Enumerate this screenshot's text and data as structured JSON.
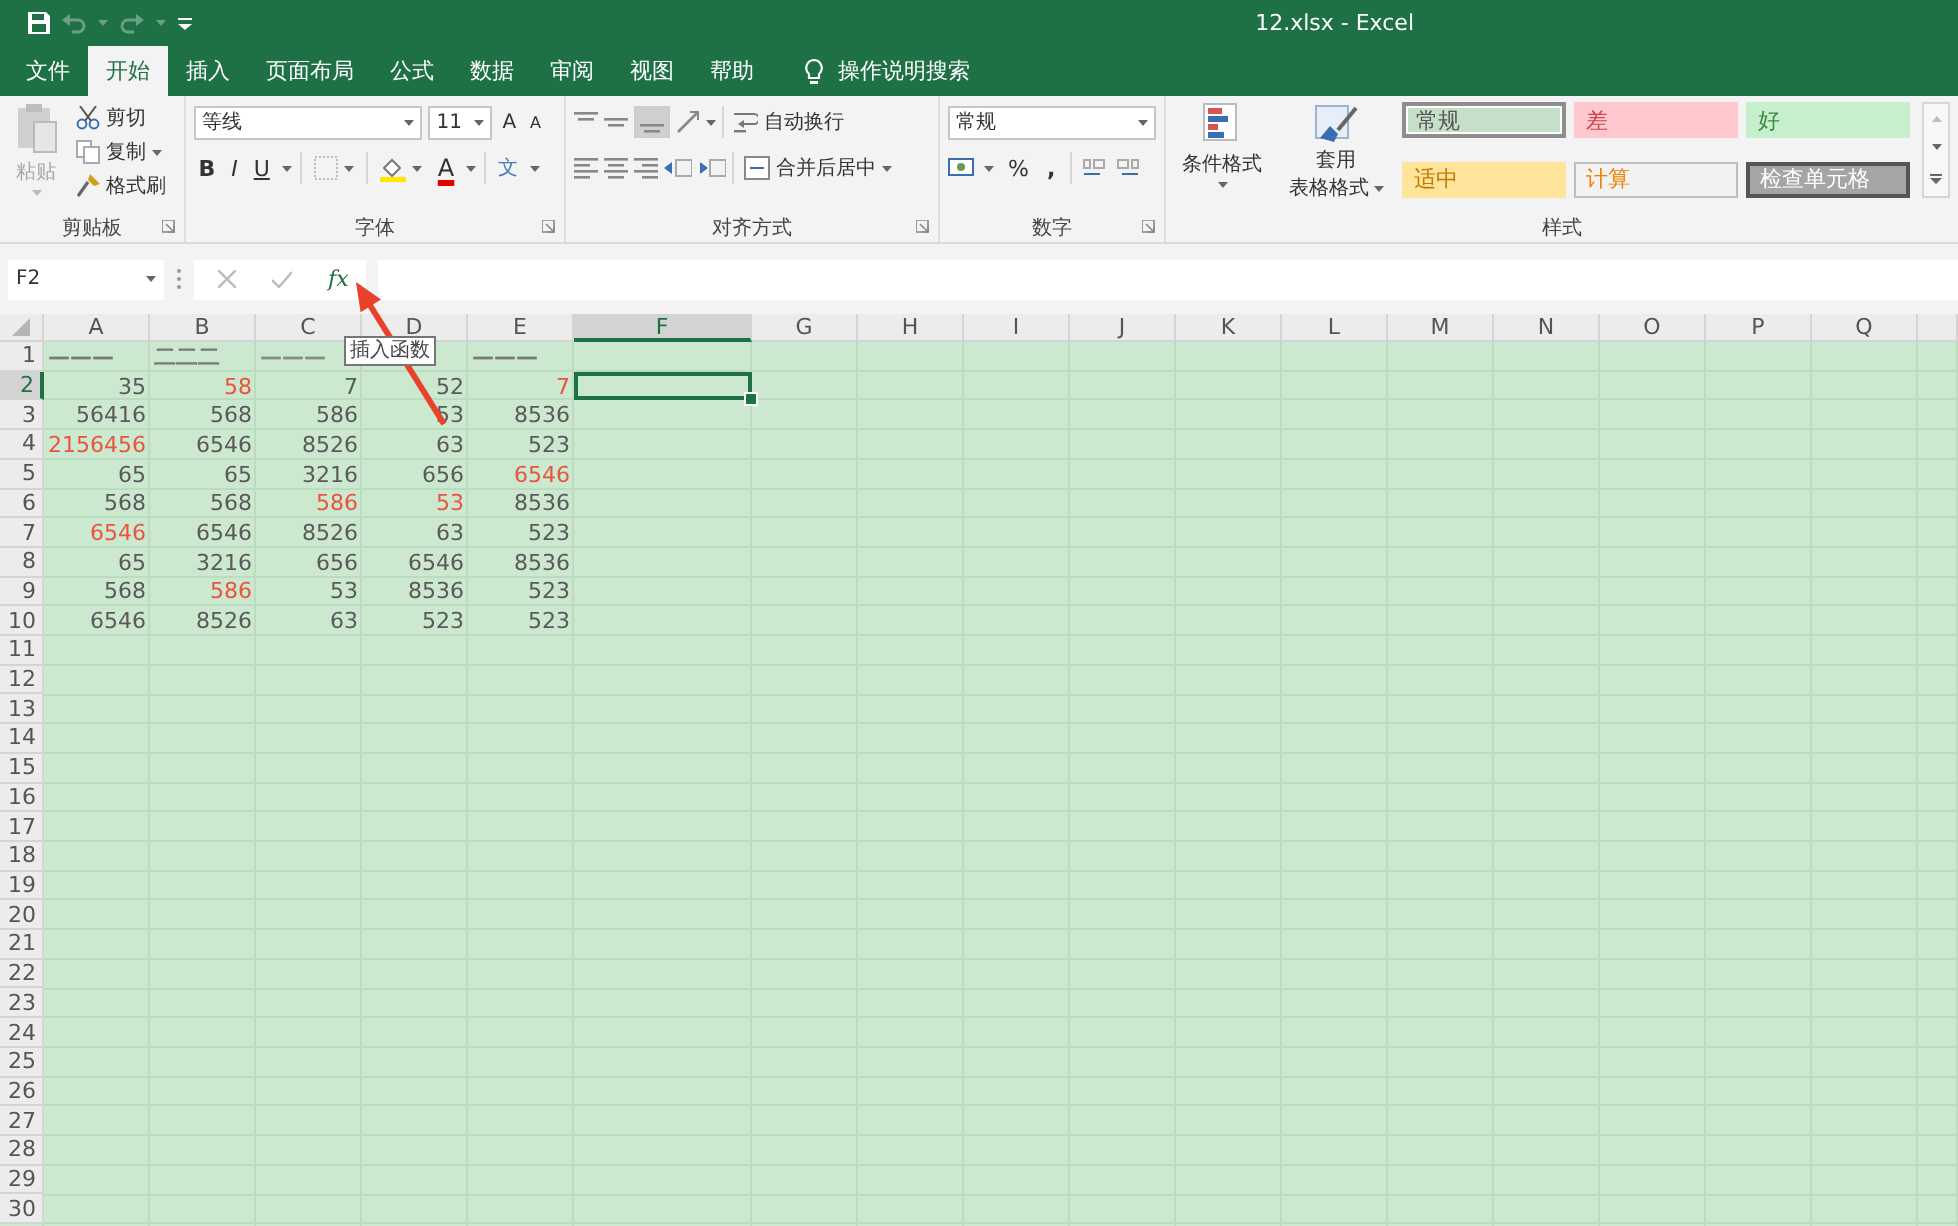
{
  "window": {
    "title": "12.xlsx  -  Excel"
  },
  "tabs": [
    {
      "label": "文件",
      "selected": false
    },
    {
      "label": "开始",
      "selected": true
    },
    {
      "label": "插入",
      "selected": false
    },
    {
      "label": "页面布局",
      "selected": false
    },
    {
      "label": "公式",
      "selected": false
    },
    {
      "label": "数据",
      "selected": false
    },
    {
      "label": "审阅",
      "selected": false
    },
    {
      "label": "视图",
      "selected": false
    },
    {
      "label": "帮助",
      "selected": false
    }
  ],
  "tell_me": {
    "label": "操作说明搜索"
  },
  "ribbon": {
    "clipboard": {
      "label": "剪贴板",
      "paste": {
        "label": "粘贴",
        "disabled": true
      },
      "cut": "剪切",
      "copy": "复制",
      "format_painter": "格式刷"
    },
    "font": {
      "label": "字体",
      "font_name": "等线",
      "font_size": "11",
      "grow": "A",
      "shrink": "A",
      "bold": "B",
      "italic": "I",
      "underline": "U",
      "font_color": "A",
      "phonetic": "文"
    },
    "alignment": {
      "label": "对齐方式",
      "wrap_text": "自动换行",
      "merge_center": "合并后居中"
    },
    "number": {
      "label": "数字",
      "format": "常规",
      "percent": "%",
      "comma": ","
    },
    "styles": {
      "label": "样式",
      "conditional_formatting": "条件格式",
      "format_as_table": [
        "套用",
        "表格格式"
      ],
      "cell_styles": [
        {
          "label": "常规",
          "kind": "normal",
          "selected": true
        },
        {
          "label": "差",
          "kind": "bad",
          "selected": false
        },
        {
          "label": "好",
          "kind": "good",
          "selected": false
        },
        {
          "label": "适中",
          "kind": "neutral",
          "selected": false
        },
        {
          "label": "计算",
          "kind": "calculation",
          "selected": false
        },
        {
          "label": "检查单元格",
          "kind": "check",
          "selected": false
        }
      ]
    }
  },
  "formula_bar": {
    "name_box": "F2",
    "insert_function": "fx"
  },
  "tooltip": "插入函数",
  "sheet": {
    "columns": [
      {
        "label": "A",
        "selected": false
      },
      {
        "label": "B",
        "selected": false
      },
      {
        "label": "C",
        "selected": false
      },
      {
        "label": "D",
        "selected": false
      },
      {
        "label": "E",
        "selected": false
      },
      {
        "label": "F",
        "selected": true
      },
      {
        "label": "G",
        "selected": false
      },
      {
        "label": "H",
        "selected": false
      },
      {
        "label": "I",
        "selected": false
      },
      {
        "label": "J",
        "selected": false
      },
      {
        "label": "K",
        "selected": false
      },
      {
        "label": "L",
        "selected": false
      },
      {
        "label": "M",
        "selected": false
      },
      {
        "label": "N",
        "selected": false
      },
      {
        "label": "O",
        "selected": false
      },
      {
        "label": "P",
        "selected": false
      },
      {
        "label": "Q",
        "selected": false
      }
    ],
    "rows": [
      {
        "label": "1",
        "selected": false,
        "cells": [
          {
            "text": "———",
            "color": "#7a7a7a"
          },
          {
            "text": "二二二",
            "color": "#7a7a7a"
          },
          {
            "text": "———",
            "color": "#8a8a8a"
          },
          null,
          {
            "text": "———",
            "color": "#7a7a7a"
          }
        ]
      },
      {
        "label": "2",
        "selected": true,
        "cells": [
          {
            "text": "35",
            "color": "#5a5a5a"
          },
          {
            "text": "58",
            "color": "#e8553e"
          },
          {
            "text": "7",
            "color": "#5a5a5a"
          },
          {
            "text": "52",
            "color": "#5a5a5a"
          },
          {
            "text": "7",
            "color": "#e8553e"
          }
        ]
      },
      {
        "label": "3",
        "selected": false,
        "cells": [
          {
            "text": "56416",
            "color": "#5a5a5a"
          },
          {
            "text": "568",
            "color": "#5a5a5a"
          },
          {
            "text": "586",
            "color": "#5a5a5a"
          },
          {
            "text": "53",
            "color": "#5a5a5a"
          },
          {
            "text": "8536",
            "color": "#5a5a5a"
          }
        ]
      },
      {
        "label": "4",
        "selected": false,
        "cells": [
          {
            "text": "2156456",
            "color": "#e8553e"
          },
          {
            "text": "6546",
            "color": "#5a5a5a"
          },
          {
            "text": "8526",
            "color": "#5a5a5a"
          },
          {
            "text": "63",
            "color": "#5a5a5a"
          },
          {
            "text": "523",
            "color": "#5a5a5a"
          }
        ]
      },
      {
        "label": "5",
        "selected": false,
        "cells": [
          {
            "text": "65",
            "color": "#5a5a5a"
          },
          {
            "text": "65",
            "color": "#5a5a5a"
          },
          {
            "text": "3216",
            "color": "#5a5a5a"
          },
          {
            "text": "656",
            "color": "#5a5a5a"
          },
          {
            "text": "6546",
            "color": "#e8553e"
          }
        ]
      },
      {
        "label": "6",
        "selected": false,
        "cells": [
          {
            "text": "568",
            "color": "#5a5a5a"
          },
          {
            "text": "568",
            "color": "#5a5a5a"
          },
          {
            "text": "586",
            "color": "#e8553e"
          },
          {
            "text": "53",
            "color": "#e8553e"
          },
          {
            "text": "8536",
            "color": "#5a5a5a"
          }
        ]
      },
      {
        "label": "7",
        "selected": false,
        "cells": [
          {
            "text": "6546",
            "color": "#e8553e"
          },
          {
            "text": "6546",
            "color": "#5a5a5a"
          },
          {
            "text": "8526",
            "color": "#5a5a5a"
          },
          {
            "text": "63",
            "color": "#5a5a5a"
          },
          {
            "text": "523",
            "color": "#5a5a5a"
          }
        ]
      },
      {
        "label": "8",
        "selected": false,
        "cells": [
          {
            "text": "65",
            "color": "#5a5a5a"
          },
          {
            "text": "3216",
            "color": "#5a5a5a"
          },
          {
            "text": "656",
            "color": "#5a5a5a"
          },
          {
            "text": "6546",
            "color": "#5a5a5a"
          },
          {
            "text": "8536",
            "color": "#5a5a5a"
          }
        ]
      },
      {
        "label": "9",
        "selected": false,
        "cells": [
          {
            "text": "568",
            "color": "#5a5a5a"
          },
          {
            "text": "586",
            "color": "#e8553e"
          },
          {
            "text": "53",
            "color": "#5a5a5a"
          },
          {
            "text": "8536",
            "color": "#5a5a5a"
          },
          {
            "text": "523",
            "color": "#5a5a5a"
          }
        ]
      },
      {
        "label": "10",
        "selected": false,
        "cells": [
          {
            "text": "6546",
            "color": "#5a5a5a"
          },
          {
            "text": "8526",
            "color": "#5a5a5a"
          },
          {
            "text": "63",
            "color": "#5a5a5a"
          },
          {
            "text": "523",
            "color": "#5a5a5a"
          },
          {
            "text": "523",
            "color": "#5a5a5a"
          }
        ]
      },
      {
        "label": "11",
        "selected": false
      },
      {
        "label": "12",
        "selected": false
      },
      {
        "label": "13",
        "selected": false
      },
      {
        "label": "14",
        "selected": false
      },
      {
        "label": "15",
        "selected": false
      },
      {
        "label": "16",
        "selected": false
      },
      {
        "label": "17",
        "selected": false
      },
      {
        "label": "18",
        "selected": false
      },
      {
        "label": "19",
        "selected": false
      },
      {
        "label": "20",
        "selected": false
      },
      {
        "label": "21",
        "selected": false
      },
      {
        "label": "22",
        "selected": false
      },
      {
        "label": "23",
        "selected": false
      },
      {
        "label": "24",
        "selected": false
      },
      {
        "label": "25",
        "selected": false
      },
      {
        "label": "26",
        "selected": false
      },
      {
        "label": "27",
        "selected": false
      },
      {
        "label": "28",
        "selected": false
      },
      {
        "label": "29",
        "selected": false
      },
      {
        "label": "30",
        "selected": false
      }
    ]
  }
}
